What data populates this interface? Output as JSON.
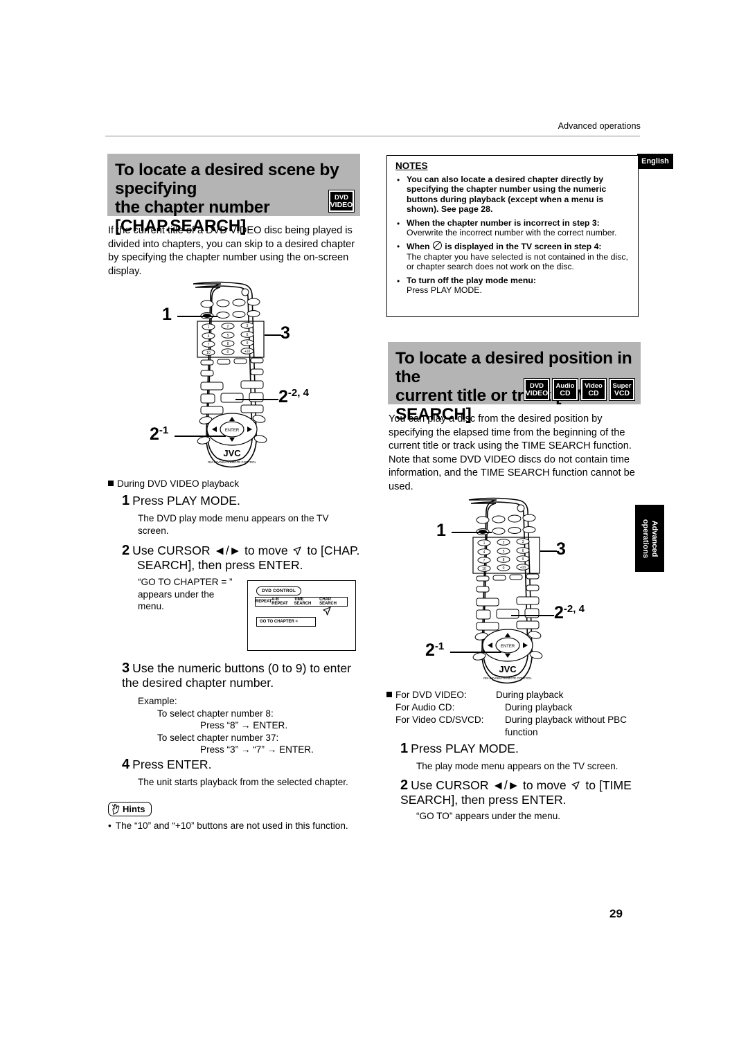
{
  "header": {
    "running_head": "Advanced operations",
    "language_tab": "English",
    "side_tab_line1": "Advanced",
    "side_tab_line2": "operations"
  },
  "page_number": "29",
  "section1": {
    "heading_line1": "To locate a desired scene by specifying",
    "heading_line2": "the chapter number [CHAP.SEARCH]",
    "badges": [
      {
        "line1": "DVD",
        "line2": "VIDEO"
      }
    ],
    "intro": "If the current title of a DVD VIDEO disc being played is divided into chapters, you can skip to a desired chapter by specifying the chapter number using the on-screen display.",
    "remote_callouts": {
      "c1": "1",
      "c3": "3",
      "c2_2_main": "2",
      "c2_2_sub": "-2, 4",
      "c2_1_main": "2",
      "c2_1_sub": "-1"
    },
    "remote_brand": "JVC",
    "remote_model": "RM-SXV065A REMOTE CONTROL",
    "condition": "During DVD VIDEO playback",
    "steps": [
      {
        "num": "1",
        "title": "Press PLAY MODE.",
        "detail": "The DVD play mode menu appears on the TV screen."
      },
      {
        "num": "2",
        "title_a": "Use CURSOR ",
        "title_b": " to move ",
        "title_c": " to [CHAP.",
        "title_d": "SEARCH], then press ENTER.",
        "cursor_keys": "◄/►",
        "detail_line1": "“GO TO CHAPTER = ”",
        "detail_line2": "appears under the",
        "detail_line3": "menu."
      },
      {
        "num": "3",
        "title": "Use the numeric buttons (0 to 9) to enter the desired chapter number.",
        "example_label": "Example:",
        "ex_line1": "To select chapter number 8:",
        "ex_line2": "Press “8” → ENTER.",
        "ex_line3": "To select chapter number 37:",
        "ex_line4": "Press “3” → “7” → ENTER."
      },
      {
        "num": "4",
        "title": "Press ENTER.",
        "detail": "The unit starts playback from the selected chapter."
      }
    ],
    "tv_screen": {
      "menu_title": "DVD CONTROL",
      "menu_items": [
        "REPEAT",
        "A-B REPEAT",
        "TIME SEARCH",
        "CHAP. SEARCH"
      ],
      "field_label": "GO TO CHAPTER ="
    },
    "hints": {
      "label": "Hints",
      "items": [
        "The “10” and “+10” buttons are not used in this function."
      ]
    }
  },
  "notes": {
    "title": "NOTES",
    "items": [
      {
        "bold": "You can also locate a desired chapter directly by specifying the chapter number using the numeric buttons during playback (except when a menu is shown). See page 28.",
        "normal": ""
      },
      {
        "bold": "When the chapter number is incorrect in step 3:",
        "normal": "Overwrite the incorrect number with the correct number."
      },
      {
        "bold_pre": "When ",
        "bold_post": " is displayed in the TV screen in step 4:",
        "normal": "The chapter you have selected is not contained in the disc, or chapter search does not work on the disc.",
        "has_symbol": true
      },
      {
        "bold": "To turn off the play mode menu:",
        "normal": "Press PLAY MODE."
      }
    ]
  },
  "section2": {
    "heading_line1": "To locate a desired position in the",
    "heading_line2": "current title or track [TIME SEARCH]",
    "badges": [
      {
        "line1": "DVD",
        "line2": "VIDEO"
      },
      {
        "line1": "Audio",
        "line2": "CD"
      },
      {
        "line1": "Video",
        "line2": "CD"
      },
      {
        "line1": "Super",
        "line2": "VCD"
      }
    ],
    "intro": "You can play a disc from the desired position by specifying the elapsed time from the beginning of the current title or track using the TIME SEARCH function. Note that some DVD VIDEO discs do not contain time information, and the TIME SEARCH function cannot be used.",
    "remote_callouts": {
      "c1": "1",
      "c3": "3",
      "c2_2_main": "2",
      "c2_2_sub": "-2, 4",
      "c2_1_main": "2",
      "c2_1_sub": "-1"
    },
    "remote_brand": "JVC",
    "remote_model": "RM-SXV065A REMOTE CONTROL",
    "conditions": [
      {
        "label": "For DVD VIDEO:",
        "value": "During playback"
      },
      {
        "label": "For Audio CD:",
        "value": "During playback"
      },
      {
        "label": "For Video CD/SVCD:",
        "value": "During playback without PBC"
      },
      {
        "label": "",
        "value": "function"
      }
    ],
    "steps": [
      {
        "num": "1",
        "title": "Press PLAY MODE.",
        "detail": "The play mode menu appears on the TV screen."
      },
      {
        "num": "2",
        "title_a": "Use CURSOR ",
        "title_b": " to move ",
        "title_c": " to [TIME",
        "title_d": "SEARCH],  then press ENTER.",
        "cursor_keys": "◄/►",
        "detail": "“GO TO” appears under the menu."
      }
    ]
  }
}
